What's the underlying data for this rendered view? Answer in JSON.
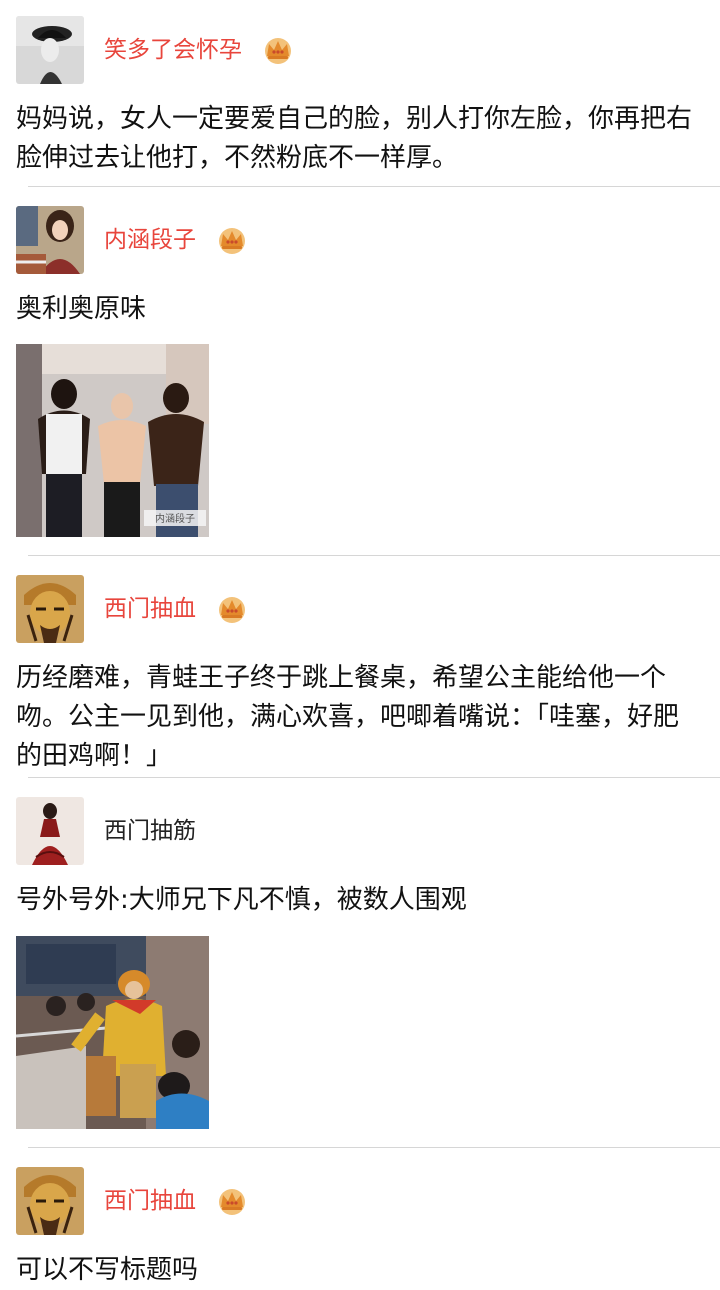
{
  "posts": [
    {
      "username": "笑多了会怀孕",
      "vip": true,
      "text": "妈妈说，女人一定要爱自己的脸，别人打你左脸，你再把右脸伸过去让他打，不然粉底不一样厚。"
    },
    {
      "username": "内涵段子",
      "vip": true,
      "text": "奥利奥原味",
      "image_watermark": "内涵段子"
    },
    {
      "username": "西门抽血",
      "vip": true,
      "text": "历经磨难，青蛙王子终于跳上餐桌，希望公主能给他一个吻。公主一见到他，满心欢喜，吧唧着嘴说：「哇塞，好肥的田鸡啊！」"
    },
    {
      "username": "西门抽筋",
      "vip": false,
      "text": "号外号外:大师兄下凡不慎，被数人围观"
    },
    {
      "username": "西门抽血",
      "vip": true,
      "text": "可以不写标题吗"
    }
  ],
  "colors": {
    "vip_name": "#e8453c",
    "name": "#222222",
    "divider": "#d6d6d6",
    "crown": "#e9a23b"
  },
  "icons": {
    "vip_badge": "crown-icon"
  }
}
